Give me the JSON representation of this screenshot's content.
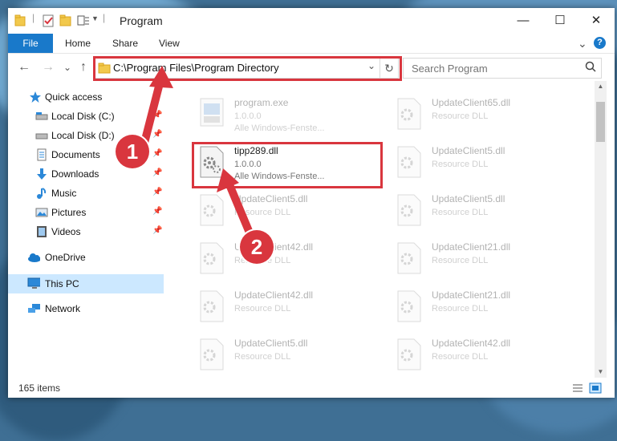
{
  "window": {
    "title": "Program",
    "minimize": "—",
    "maximize": "☐",
    "close": "✕"
  },
  "ribbon": {
    "tabs": [
      "File",
      "Home",
      "Share",
      "View"
    ],
    "collapse": "⌄",
    "help": "?"
  },
  "address": {
    "path": "C:\\Program Files\\Program Directory",
    "chevron": "⌄",
    "refresh": "↻"
  },
  "search": {
    "placeholder": "Search Program",
    "icon": "search-icon"
  },
  "nav": {
    "back": "←",
    "forward": "→",
    "recent": "⌄",
    "up": "↑",
    "items": [
      {
        "label": "Quick access",
        "icon": "star-icon"
      },
      {
        "label": "Local Disk (C:)",
        "icon": "drive-icon"
      },
      {
        "label": "Local Disk (D:)",
        "icon": "drive-icon"
      },
      {
        "label": "Documents",
        "icon": "documents-icon"
      },
      {
        "label": "Downloads",
        "icon": "download-icon"
      },
      {
        "label": "Music",
        "icon": "music-icon"
      },
      {
        "label": "Pictures",
        "icon": "pictures-icon"
      },
      {
        "label": "Videos",
        "icon": "videos-icon"
      },
      {
        "label": "OneDrive",
        "icon": "cloud-icon"
      },
      {
        "label": "This PC",
        "icon": "pc-icon"
      },
      {
        "label": "Network",
        "icon": "network-icon"
      }
    ],
    "pin": "📌"
  },
  "files": {
    "left": [
      {
        "name": "program.exe",
        "line1": "1.0.0.0",
        "line2": "Alle Windows-Fenste..."
      },
      {
        "name": "tipp289.dll",
        "line1": "1.0.0.0",
        "line2": "Alle Windows-Fenste..."
      },
      {
        "name": "UpdateClient5.dll",
        "line1": "Resource DLL",
        "line2": ""
      },
      {
        "name": "UpdateClient42.dll",
        "line1": "Resource DLL",
        "line2": ""
      },
      {
        "name": "UpdateClient42.dll",
        "line1": "Resource DLL",
        "line2": ""
      },
      {
        "name": "UpdateClient5.dll",
        "line1": "Resource DLL",
        "line2": ""
      }
    ],
    "right": [
      {
        "name": "UpdateClient65.dll",
        "line1": "Resource DLL"
      },
      {
        "name": "UpdateClient5.dll",
        "line1": "Resource DLL"
      },
      {
        "name": "UpdateClient5.dll",
        "line1": "Resource DLL"
      },
      {
        "name": "UpdateClient21.dll",
        "line1": "Resource DLL"
      },
      {
        "name": "UpdateClient21.dll",
        "line1": "Resource DLL"
      },
      {
        "name": "UpdateClient42.dll",
        "line1": "Resource DLL"
      }
    ]
  },
  "status": {
    "count": "165 items"
  },
  "steps": [
    "1",
    "2"
  ],
  "colors": {
    "accent": "#1979ca",
    "highlight": "#d9363e",
    "selected": "#cce8ff"
  }
}
